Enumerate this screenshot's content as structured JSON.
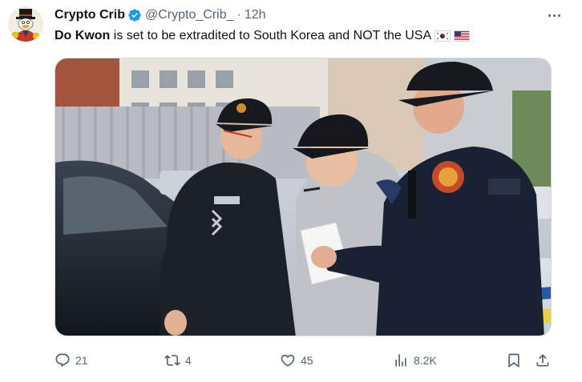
{
  "author": {
    "display_name": "Crypto Crib",
    "handle": "@Crypto_Crib_",
    "separator": "·",
    "time": "12h",
    "verified_color": "#1d9bf0",
    "avatar_icon": "avatar-image"
  },
  "tweet": {
    "bold_text": "Do Kwon",
    "rest_text": " is set to be extradited to South Korea and NOT the USA",
    "flags": [
      "south-korea-flag-icon",
      "usa-flag-icon"
    ]
  },
  "media": {
    "icon": "photo-police-escort"
  },
  "actions": {
    "reply_count": "21",
    "retweet_count": "4",
    "like_count": "45",
    "views_count": "8.2K"
  },
  "colors": {
    "text_primary": "#0f1419",
    "text_secondary": "#536471",
    "border": "#cfd9de"
  }
}
